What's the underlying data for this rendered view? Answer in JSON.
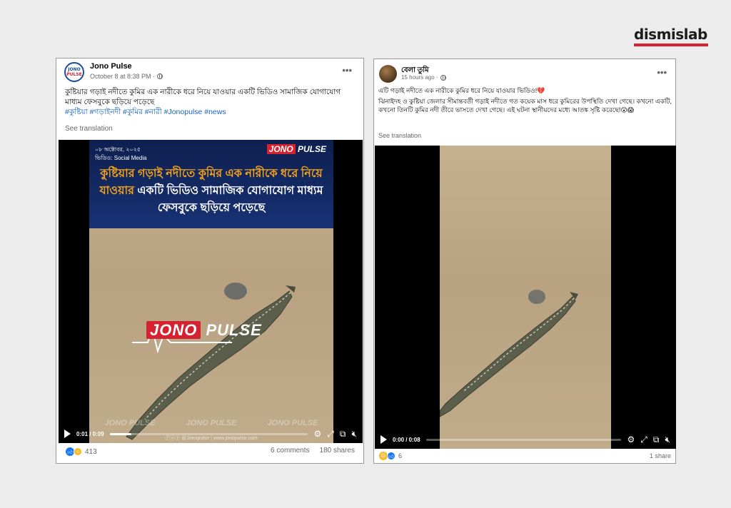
{
  "brand": {
    "name": "dismislab",
    "accent": "#d62230"
  },
  "left_post": {
    "avatar_line1": "JONO",
    "avatar_line2": "PULSE",
    "page_name": "Jono Pulse",
    "timestamp": "October 8 at 8:38 PM ·",
    "caption": "কুষ্টিয়ার গড়াই নদীতে কুমির এক নারীকে ধরে নিয়ে যাওয়ার একটি ভিডিও সামাজিক যোগাযোগ মাধ্যম ফেসবুকে ছড়িয়ে পড়েছে",
    "hashtags": "#কুষ্টিয়া #গড়াইনদী #কুমির #নারী #Jonopulse #news",
    "see_translation": "See translation",
    "video": {
      "banner_date": "০৮ অক্টোবর, ২০২৫",
      "banner_source": "ভিডিও: Social Media",
      "banner_logo_j": "JONO",
      "banner_logo_rest": " PULSE",
      "headline_highlight": "কুষ্টিয়ার গড়াই নদীতে কুমির এক নারীকে ধরে নিয়ে যাওয়ার",
      "headline_rest": " একটি ভিডিও সামাজিক যোগাযোগ মাধ্যম ফেসবুকে ছড়িয়ে পড়েছে",
      "watermark_j": "JONO",
      "watermark_rest": " PULSE",
      "watermark_row": [
        "JONO PULSE",
        "JONO PULSE",
        "JONO PULSE"
      ],
      "footer": "ⓕⓞⓨ @Jonopulse | www.jonopulse.com",
      "timecode": "0:01 / 0:09",
      "progress": 0.11
    },
    "reaction_count": "413",
    "comments": "6 comments",
    "shares": "180 shares"
  },
  "right_post": {
    "page_name": "বেলা তুমি",
    "timestamp": "15 hours ago ·",
    "caption_line1": "এটি গড়াই নদীতে এক নারীকে কুমির ধরে নিয়ে যাওয়ার ভিডিও!💔",
    "caption_para2": "ঝিনাইদহ ও কুষ্টিয়া জেলার সীমান্তবর্তী গড়াই নদীতে গত কয়েক মাস ধরে কুমিরের উপস্থিতি দেখা গেছে। কখনো একটি, কখনো তিনটি কুমির নদী তীরে ভাসতে দেখা গেছে। এই ঘটনা স্থানীয়দের মধ্যে আতঙ্ক সৃষ্টি করেছে!😮😱",
    "see_translation": "See translation",
    "video": {
      "timecode": "0:00 / 0:08",
      "progress": 0.0
    },
    "reaction_count": "6",
    "shares": "1 share"
  }
}
